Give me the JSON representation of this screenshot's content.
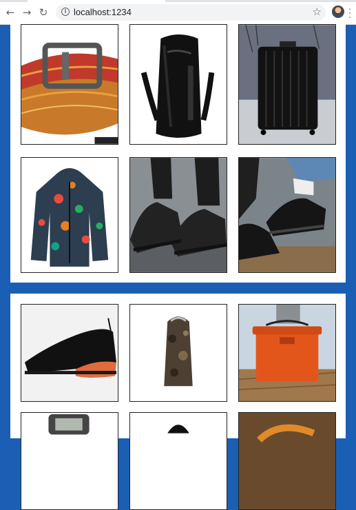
{
  "browser": {
    "url": "localhost:1234",
    "back_icon": "arrow-back-icon",
    "forward_icon": "arrow-forward-icon",
    "reload_icon": "reload-icon",
    "info_icon": "info-icon",
    "bookmark_icon": "star-icon",
    "menu_icon": "menu-dots-icon"
  },
  "products": [
    {
      "name": "belt",
      "caption": ""
    },
    {
      "name": "backpack",
      "caption": ""
    },
    {
      "name": "suitcase",
      "caption": ""
    },
    {
      "name": "floral-jacket",
      "caption": ""
    },
    {
      "name": "sneakers-worn",
      "caption": ""
    },
    {
      "name": "sneakers-splash",
      "caption": ""
    },
    {
      "name": "black-sneaker",
      "caption": ""
    },
    {
      "name": "camo-parka",
      "caption": ""
    },
    {
      "name": "cooler",
      "caption": ""
    }
  ],
  "colors": {
    "page_background": "#1a5fb4",
    "card_background": "#ffffff",
    "tile_border": "#222222"
  }
}
